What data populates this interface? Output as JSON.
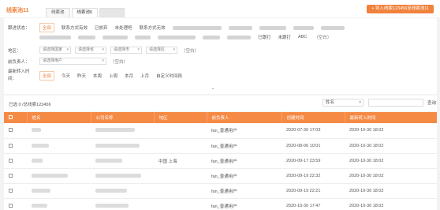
{
  "header": {
    "title": "线索池11",
    "tabs": [
      {
        "label": "线索池",
        "state": "normal"
      },
      {
        "label": "线索池6",
        "state": "active"
      },
      {
        "label": "",
        "state": "blurred"
      }
    ],
    "import_button": "+ 导入线索123456至线索池11"
  },
  "filters": {
    "status": {
      "label": "跟进状态：",
      "options": [
        "全部",
        "联系方式有效",
        "已放弃",
        "未处理吧",
        "联系方式无效"
      ],
      "options_row2": [
        "已跟打",
        "未跟打",
        "ABC",
        "（空白）"
      ],
      "selected": "全部"
    },
    "region": {
      "label": "地区：",
      "selects": [
        "请选择国家",
        "请选择省",
        "请选择市",
        "请选择区"
      ],
      "empty": "（空白）"
    },
    "owner": {
      "label": "前负责人：",
      "select": "请选择用户",
      "empty": "（空白）"
    },
    "time": {
      "label_line1": "最新转入时",
      "label_line2": "间：",
      "options": [
        "全部",
        "今天",
        "昨天",
        "本周",
        "上周",
        "本月",
        "上月",
        "自定义时间段"
      ],
      "selected": "全部"
    }
  },
  "listbar": {
    "selected_info": "已选 0 /总线索123456",
    "field_select": "姓名",
    "search_button": "查询"
  },
  "table": {
    "columns": [
      "",
      "姓名",
      "公司名称",
      "地区",
      "前负责人",
      "创建时间",
      "最新转入时间"
    ],
    "rows": [
      {
        "region": "",
        "owner": "fan_普通用户",
        "created": "2020-07-30 17:03",
        "latest": "2020-10-30 18:02"
      },
      {
        "region": "",
        "owner": "fan_普通用户",
        "created": "2020-08-06 10:01",
        "latest": "2020-10-30 18:02"
      },
      {
        "region": "中国 上海",
        "owner": "fan_普通用户",
        "created": "2020-09-17 23:59",
        "latest": "2020-10-30 18:02"
      },
      {
        "region": "",
        "owner": "fan_普通用户",
        "created": "2020-09-19 22:32",
        "latest": "2020-10-30 18:02"
      },
      {
        "region": "",
        "owner": "fan_普通用户",
        "created": "2020-09-19 22:21",
        "latest": "2020-10-30 18:02"
      },
      {
        "region": "",
        "owner": "fan_普通用户",
        "created": "2020-10-30 17:47",
        "latest": "2020-10-30 18:02"
      }
    ]
  },
  "colors": {
    "accent": "#f0823c",
    "header_bg": "#f58a45"
  }
}
